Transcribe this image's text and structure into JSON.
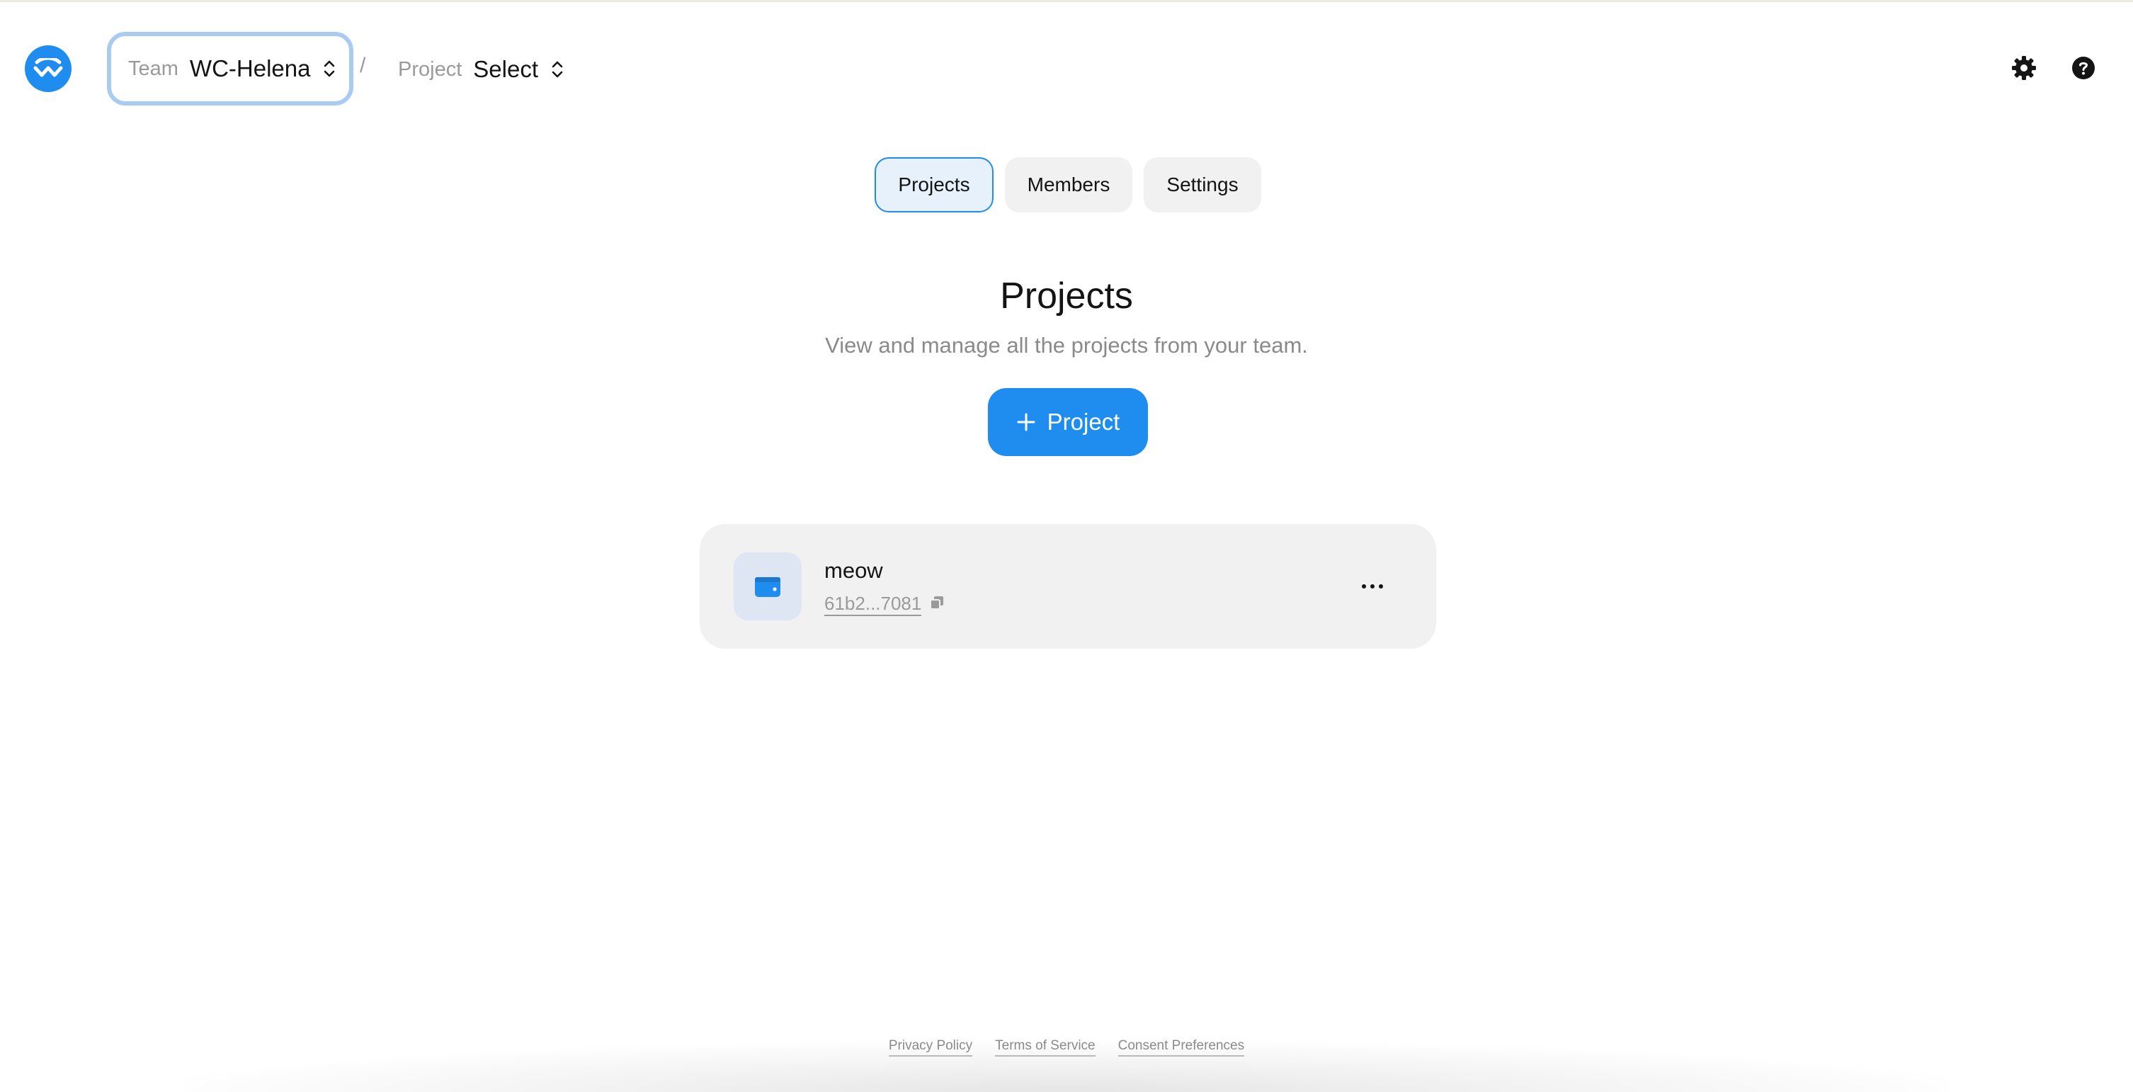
{
  "header": {
    "team": {
      "label": "Team",
      "value": "WC-Helena"
    },
    "separator": "/",
    "project": {
      "label": "Project",
      "value": "Select"
    },
    "icons": {
      "settings": "gear-icon",
      "help": "help-icon",
      "logo": "walletconnect-logo"
    }
  },
  "tabs": [
    {
      "label": "Projects",
      "active": true
    },
    {
      "label": "Members",
      "active": false
    },
    {
      "label": "Settings",
      "active": false
    }
  ],
  "main": {
    "title": "Projects",
    "subtitle": "View and manage all the projects from your team.",
    "add_button_label": "Project"
  },
  "projects": [
    {
      "name": "meow",
      "id": "61b2...7081",
      "icon": "wallet-icon"
    }
  ],
  "footer": {
    "links": [
      "Privacy Policy",
      "Terms of Service",
      "Consent Preferences"
    ]
  },
  "colors": {
    "accent": "#1f8cf0",
    "focus_ring": "#a9cbf2",
    "card_background": "#f1f1f1",
    "muted_text": "#8a8a8a"
  }
}
